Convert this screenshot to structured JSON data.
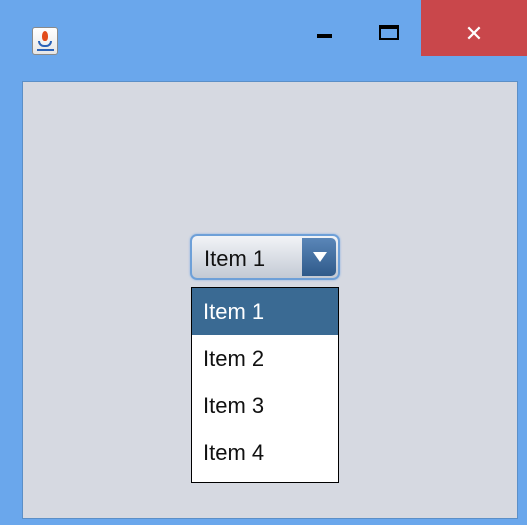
{
  "window": {
    "app_icon": "java-cup-icon",
    "controls": {
      "minimize": "minimize-icon",
      "maximize": "maximize-icon",
      "close_glyph": "✕"
    }
  },
  "combo": {
    "selected_value": "Item 1",
    "arrow_icon": "chevron-down-icon"
  },
  "dropdown": {
    "items": [
      {
        "label": "Item 1",
        "selected": true
      },
      {
        "label": "Item 2",
        "selected": false
      },
      {
        "label": "Item 3",
        "selected": false
      },
      {
        "label": "Item 4",
        "selected": false
      }
    ]
  },
  "colors": {
    "frame": "#6aa7ec",
    "close_button": "#c9474b",
    "content_bg": "#d6d9e1",
    "selection": "#3a6a93"
  }
}
